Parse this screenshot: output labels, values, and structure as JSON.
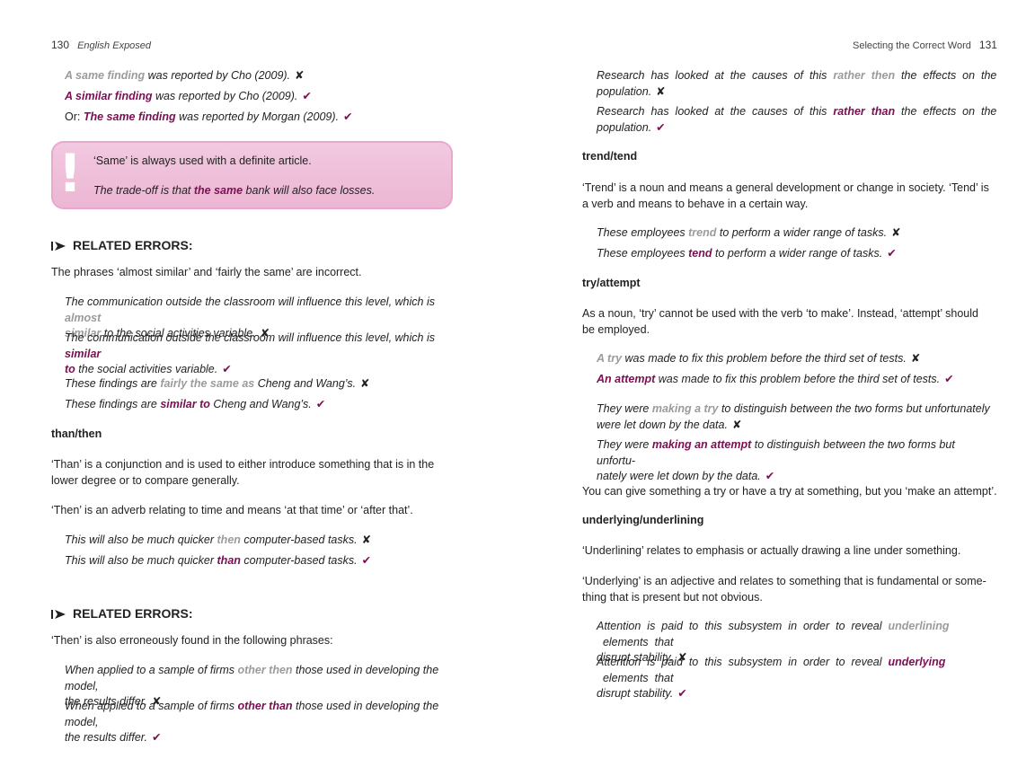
{
  "left": {
    "page_number": "130",
    "running_title": "English Exposed",
    "examples_top": [
      {
        "wrong": "A same finding",
        "rest": " was reported by Cho (2009).",
        "mark": "✘"
      },
      {
        "highlight": "A similar finding",
        "rest": " was reported by Cho (2009).",
        "mark": "✔"
      },
      {
        "prefix": "Or:  ",
        "highlight": "The same finding",
        "rest": " was reported by Morgan (2009).",
        "mark": "✔"
      }
    ],
    "callout": {
      "rule": "‘Same’ is always used with a definite article.",
      "example_pre": "The trade-off is that ",
      "example_hl": "the same",
      "example_post": " bank will also face losses."
    },
    "related_heading_1": "RELATED ERRORS:",
    "related_text_1": "The phrases ‘almost similar’ and ‘fairly the same’ are incorrect.",
    "ex_almost_wrong": {
      "pre": "The communication outside the classroom will influence this level, which is ",
      "hl": "almost",
      "hl2": "similar",
      "post": " to the social activities variable.",
      "mark": "✘"
    },
    "ex_almost_right": {
      "pre": "The communication outside the classroom will influence this level, which is ",
      "hl": "similar",
      "hl2": "to",
      "post": " the social activities variable.",
      "mark": "✔"
    },
    "ex_fairly_wrong": {
      "pre": "These findings are ",
      "hl": "fairly the same as",
      "post": " Cheng and Wang’s.",
      "mark": "✘"
    },
    "ex_fairly_right": {
      "pre": "These findings are ",
      "hl": "similar to",
      "post": " Cheng and Wang’s.",
      "mark": "✔"
    },
    "than_then_title": "than/then",
    "than_def_1": "‘Than’ is a conjunction and is used to either introduce something that is in the",
    "than_def_2": "lower degree or to compare generally.",
    "then_def": "‘Then’ is an adverb relating to time and means ‘at that time’ or ‘after that’.",
    "ex_then_wrong": {
      "pre": "This will also be much quicker ",
      "hl": "then",
      "post": " computer-based tasks.",
      "mark": "✘"
    },
    "ex_than_right": {
      "pre": "This will also be much quicker ",
      "hl": "than",
      "post": " computer-based tasks.",
      "mark": "✔"
    },
    "related_heading_2": "RELATED ERRORS:",
    "related_text_2": "‘Then’ is also erroneously found in the following phrases:",
    "ex_otherthen_wrong": {
      "pre": "When applied to a sample of firms ",
      "hl": "other then",
      "post": " those used in developing the model,",
      "line2": "the results differ.",
      "mark": "✘"
    },
    "ex_otherthan_right": {
      "pre": "When applied to a sample of firms ",
      "hl": "other than",
      "post": " those used in developing the model,",
      "line2": "the results differ.",
      "mark": "✔"
    }
  },
  "right": {
    "running_title": "Selecting the Correct Word",
    "page_number": "131",
    "ex_ratherthen_wrong": {
      "pre": "Research  has  looked  at  the  causes  of  this  ",
      "hl": "rather  then",
      "post": "  the  effects  on  the",
      "line2": "population.",
      "mark": "✘"
    },
    "ex_ratherthan_right": {
      "pre": "Research  has  looked  at  the  causes  of  this  ",
      "hl": "rather  than",
      "post": "  the  effects  on  the",
      "line2": "population.",
      "mark": "✔"
    },
    "trend_title": "trend/tend",
    "trend_def_1": "‘Trend’ is a noun and means a general development or change in society. ‘Tend’ is",
    "trend_def_2": "a verb and means to behave in a certain way.",
    "ex_trend_wrong": {
      "pre": "These employees ",
      "hl": "trend",
      "post": " to perform a wider range of tasks.",
      "mark": "✘"
    },
    "ex_tend_right": {
      "pre": "These employees ",
      "hl": "tend",
      "post": " to perform a wider range of tasks.",
      "mark": "✔"
    },
    "try_title": "try/attempt",
    "try_def_1": "As a noun, ‘try’ cannot be used with the verb ‘to make’. Instead, ‘attempt’ should",
    "try_def_2": "be employed.",
    "ex_atry_wrong": {
      "hl": "A try",
      "post": " was made to fix this problem before the third set of tests.",
      "mark": "✘"
    },
    "ex_anattempt_right": {
      "hl": "An attempt",
      "post": " was made to fix this problem before the third set of tests.",
      "mark": "✔"
    },
    "ex_makingtry_wrong": {
      "pre": "They were ",
      "hl": "making a try",
      "post": " to distinguish between the two forms but unfortunately",
      "line2": "were let down by the data.",
      "mark": "✘"
    },
    "ex_makingattempt_right": {
      "pre": "They were ",
      "hl": "making an attempt",
      "post": " to distinguish between the two forms but unfortu-",
      "line2": "nately were let down by the data.",
      "mark": "✔"
    },
    "try_note": "You can give something a try or have a try at something, but you ‘make an attempt’.",
    "underlying_title": "underlying/underlining",
    "underlining_def": "‘Underlining’ relates to emphasis or actually drawing a line under something.",
    "underlying_def_1": "‘Underlying’ is an adjective and relates to something that is fundamental or some-",
    "underlying_def_2": "thing that is present but not obvious.",
    "ex_underlining_wrong": {
      "pre": "Attention  is  paid  to  this  subsystem  in  order  to  reveal  ",
      "hl": "underlining",
      "post": "  elements  that",
      "line2": "disrupt stability.",
      "mark": "✘"
    },
    "ex_underlying_right": {
      "pre": "Attention  is  paid  to  this  subsystem  in  order  to  reveal  ",
      "hl": "underlying",
      "post": "  elements  that",
      "line2": "disrupt stability.",
      "mark": "✔"
    }
  },
  "colors": {
    "highlight": "#7a0f52",
    "wrong": "#9b9b9b",
    "callout": "#f0c3dd"
  },
  "icons": {
    "callout": "exclamation-icon",
    "related": "arrow-right-icon",
    "wrong_mark": "cross-icon",
    "right_mark": "check-icon"
  }
}
